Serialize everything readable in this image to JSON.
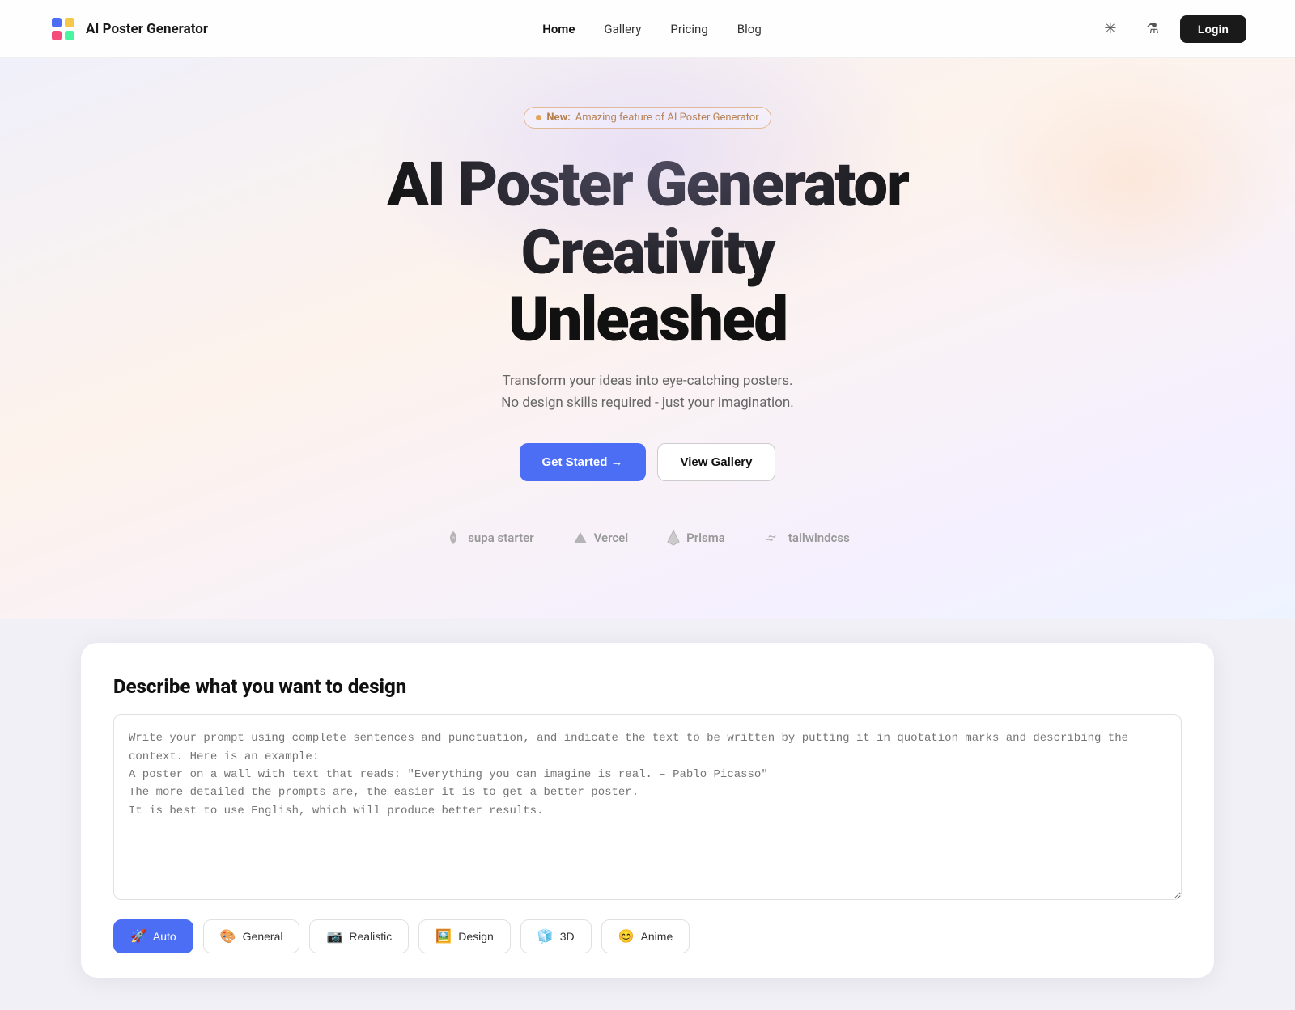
{
  "navbar": {
    "brand": "AI Poster Generator",
    "links": [
      {
        "label": "Home",
        "active": true
      },
      {
        "label": "Gallery",
        "active": false
      },
      {
        "label": "Pricing",
        "active": false
      },
      {
        "label": "Blog",
        "active": false
      }
    ],
    "login_label": "Login"
  },
  "hero": {
    "badge_new": "New:",
    "badge_text": "Amazing feature of AI Poster Generator",
    "title_line1": "AI Poster Generator",
    "title_line2": "Creativity",
    "title_line3": "Unleashed",
    "subtitle_line1": "Transform your ideas into eye-catching posters.",
    "subtitle_line2": "No design skills required - just your imagination.",
    "cta_primary": "Get Started →",
    "cta_secondary": "View Gallery"
  },
  "partners": [
    {
      "name": "supa starter",
      "icon": "rocket"
    },
    {
      "name": "Vercel",
      "icon": "triangle"
    },
    {
      "name": "Prisma",
      "icon": "gem"
    },
    {
      "name": "tailwindcss",
      "icon": "wave"
    }
  ],
  "design_section": {
    "title": "Describe what you want to design",
    "placeholder": "Write your prompt using complete sentences and punctuation, and indicate the text to be written by putting it in quotation marks and describing the context. Here is an example:\nA poster on a wall with text that reads: \"Everything you can imagine is real. – Pablo Picasso\"\nThe more detailed the prompts are, the easier it is to get a better poster.\nIt is best to use English, which will produce better results.",
    "style_tabs": [
      {
        "label": "Auto",
        "emoji": "🚀",
        "active": true
      },
      {
        "label": "General",
        "emoji": "🎨",
        "active": false
      },
      {
        "label": "Realistic",
        "emoji": "📷",
        "active": false
      },
      {
        "label": "Design",
        "emoji": "🖼️",
        "active": false
      },
      {
        "label": "3D",
        "emoji": "🧊",
        "active": false
      },
      {
        "label": "Anime",
        "emoji": "😊",
        "active": false
      }
    ]
  }
}
